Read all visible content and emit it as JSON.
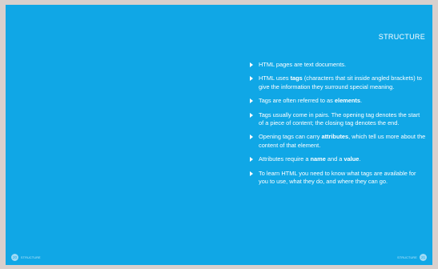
{
  "page": {
    "heading": "STRUCTURE",
    "background_color": "#10a7e6"
  },
  "summary": {
    "items": [
      [
        {
          "text": "HTML pages are text documents."
        }
      ],
      [
        {
          "text": "HTML uses "
        },
        {
          "text": "tags",
          "bold": true
        },
        {
          "text": " (characters that sit inside angled brackets) to give the information they surround special meaning."
        }
      ],
      [
        {
          "text": "Tags are often referred to as "
        },
        {
          "text": "elements",
          "bold": true
        },
        {
          "text": "."
        }
      ],
      [
        {
          "text": "Tags usually come in pairs. The opening tag denotes the start of a piece of content; the closing tag denotes the end."
        }
      ],
      [
        {
          "text": "Opening tags can carry "
        },
        {
          "text": "attributes",
          "bold": true
        },
        {
          "text": ", which tell us more about the content of that element."
        }
      ],
      [
        {
          "text": "Attributes require a "
        },
        {
          "text": "name",
          "bold": true
        },
        {
          "text": " and a "
        },
        {
          "text": "value",
          "bold": true
        },
        {
          "text": "."
        }
      ],
      [
        {
          "text": "To learn HTML you need to know what tags are available for you to use, what they do, and where they can go."
        }
      ]
    ]
  },
  "footer": {
    "left_page_number": "20",
    "left_label": "STRUCTURE",
    "right_label": "STRUCTURE",
    "right_page_number": "21"
  }
}
